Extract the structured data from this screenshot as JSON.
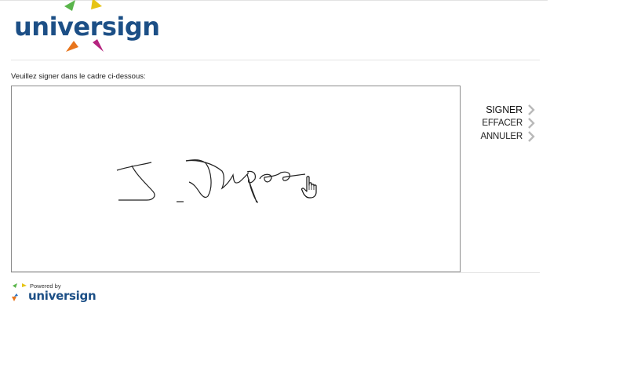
{
  "brand": {
    "logo_text": "universign",
    "colors": {
      "primary": "#1c4f86",
      "green": "#5ab54b",
      "yellow": "#e6c416",
      "orange": "#e8751c",
      "magenta": "#b5237f",
      "blue": "#2e74c3"
    }
  },
  "instruction": "Veuillez signer dans le cadre ci-dessous:",
  "actions": [
    {
      "label": "SIGNER",
      "icon": "chevron-right-icon"
    },
    {
      "label": "EFFACER",
      "icon": "chevron-right-icon"
    },
    {
      "label": "ANNULER",
      "icon": "chevron-right-icon"
    }
  ],
  "footer": {
    "powered_by": "Powered by",
    "brand": "universign"
  }
}
